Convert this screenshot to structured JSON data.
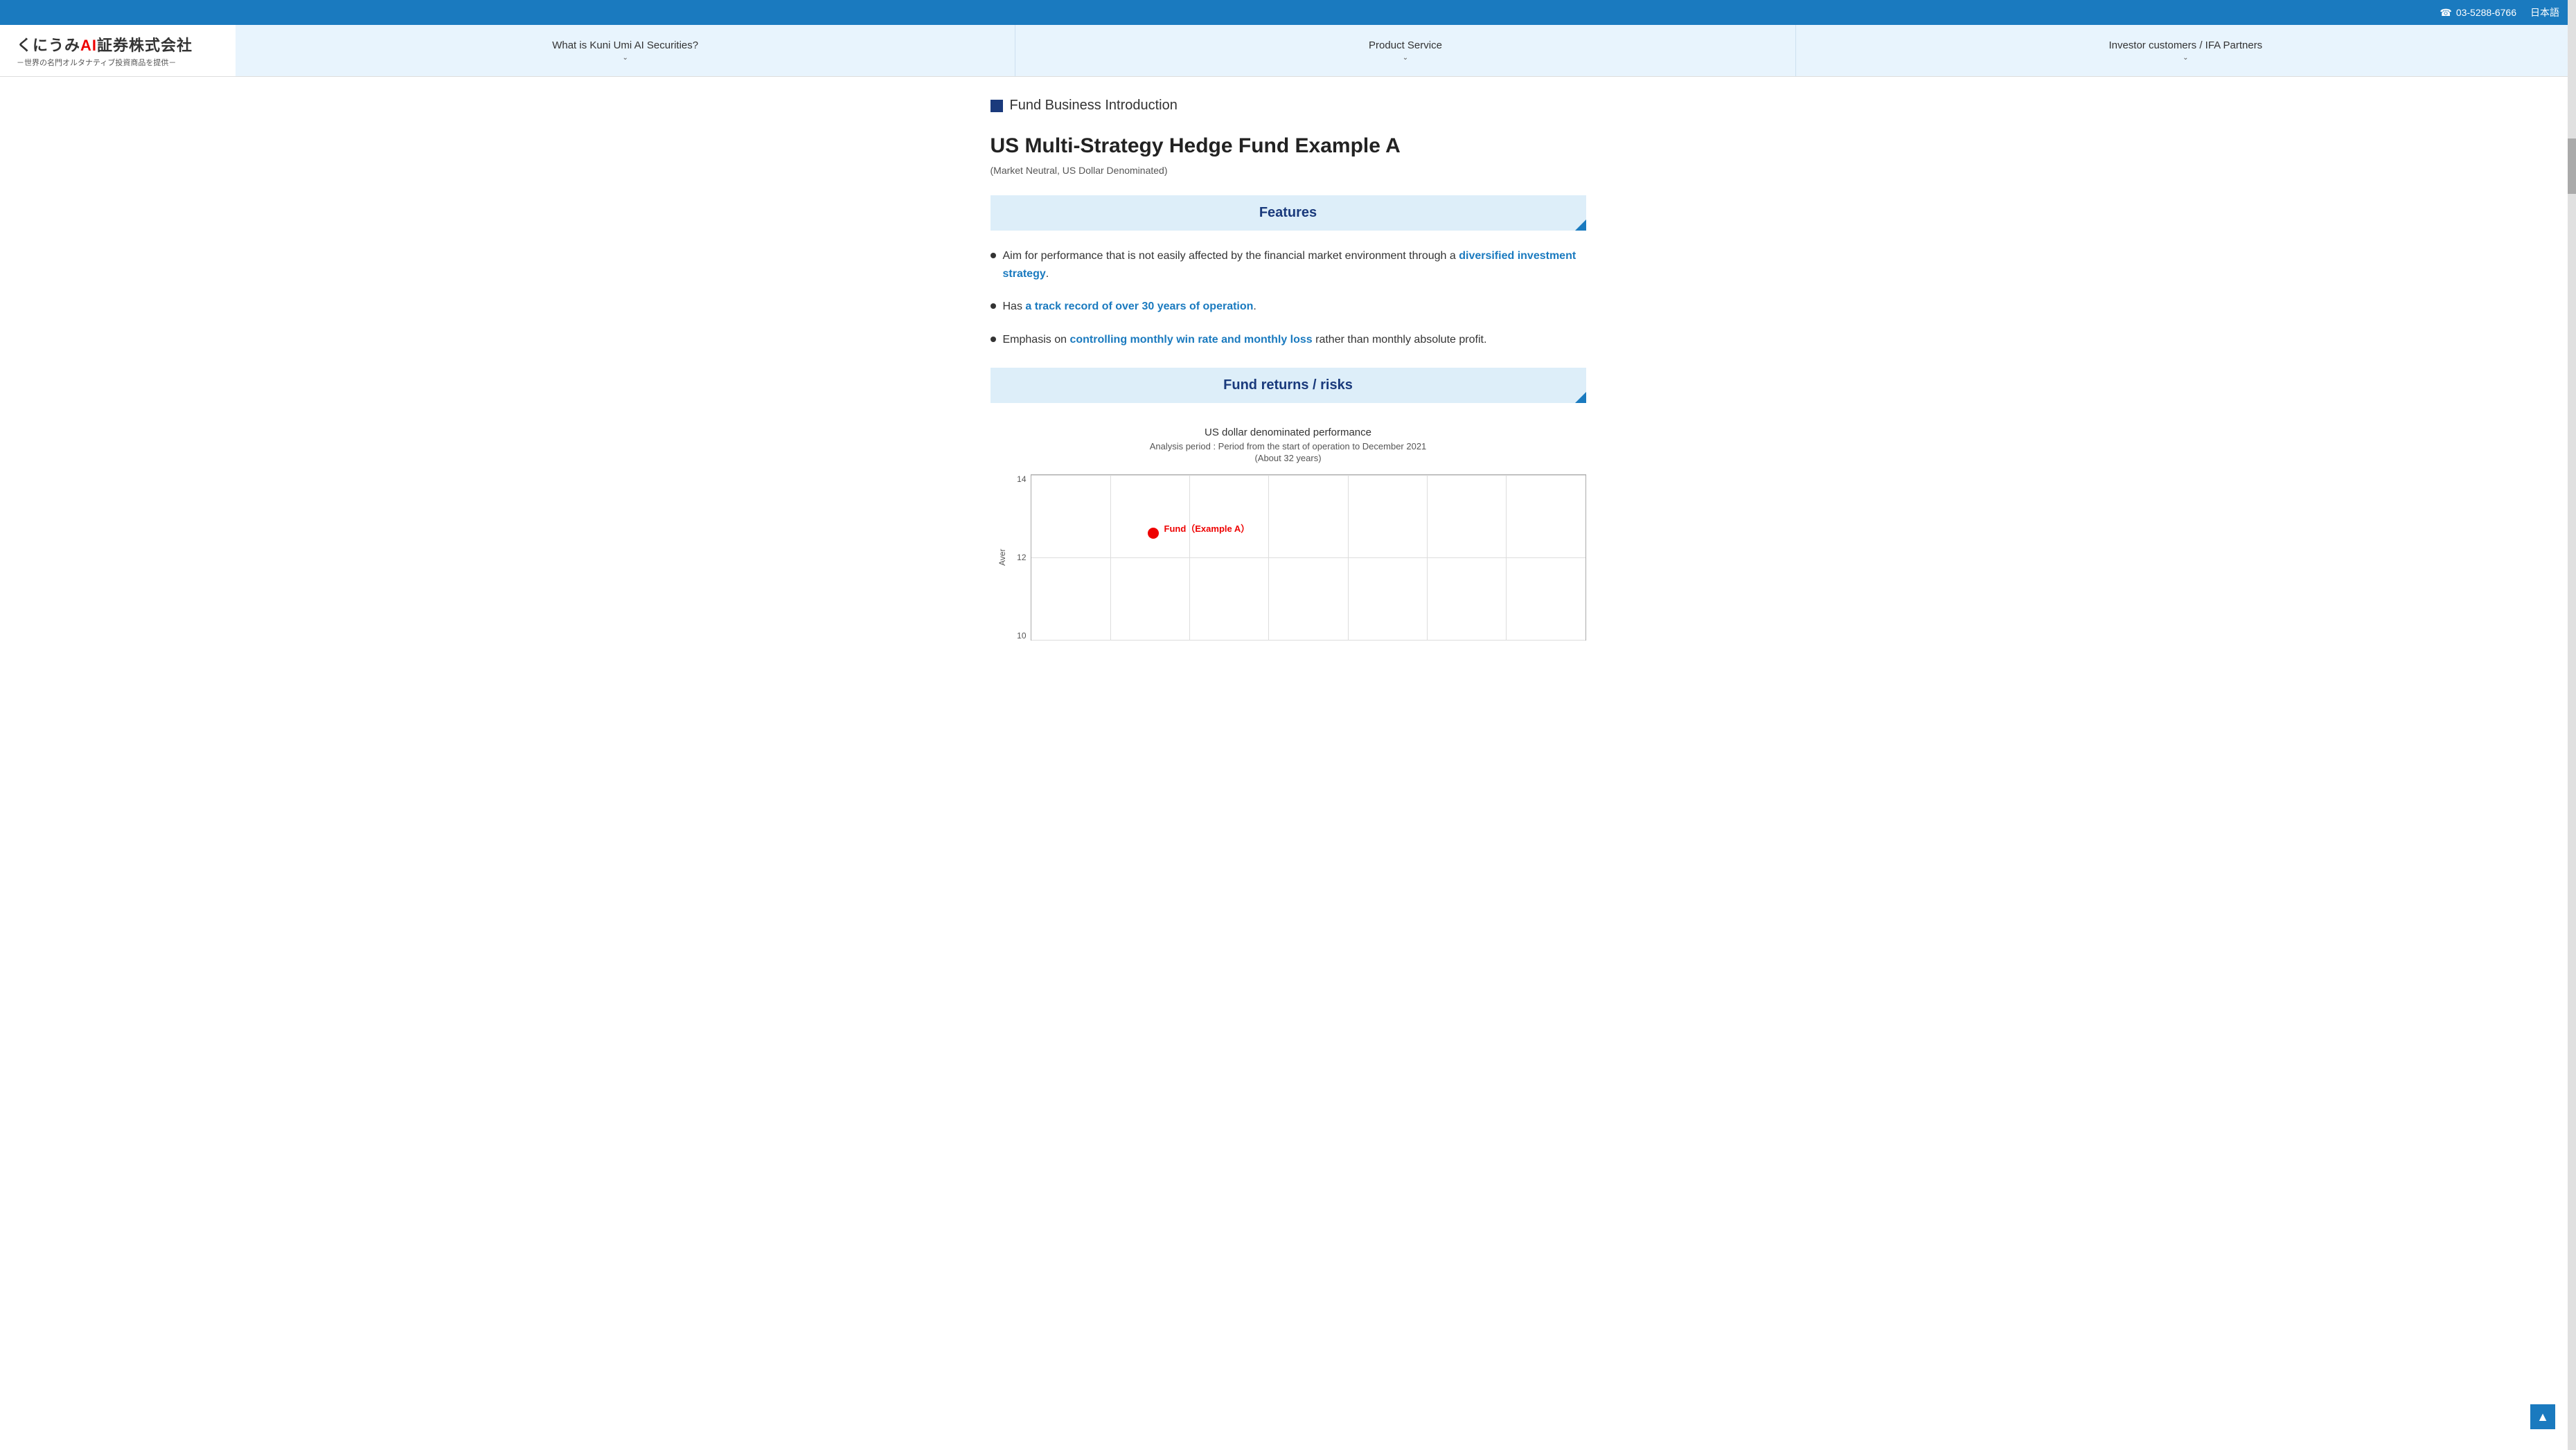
{
  "topbar": {
    "phone": "03-5288-6766",
    "phone_icon": "☎",
    "language": "日本語"
  },
  "logo": {
    "name_part1": "くにうみ",
    "name_ai": "AI",
    "name_part2": "証券株式会社",
    "tagline": "－世界の名門オルタナティブ投資商品を提供－"
  },
  "nav": {
    "items": [
      {
        "label": "What is Kuni Umi AI Securities?",
        "has_chevron": true
      },
      {
        "label": "Product Service",
        "has_chevron": true
      },
      {
        "label": "Investor customers / IFA Partners",
        "has_chevron": true
      }
    ]
  },
  "section_label": "Fund Business Introduction",
  "fund": {
    "title": "US Multi-Strategy Hedge Fund Example A",
    "subtitle": "(Market Neutral, US Dollar Denominated)"
  },
  "features": {
    "header": "Features",
    "bullets": [
      {
        "text_before": "Aim for performance that is not easily affected by the financial market environment through a ",
        "highlight": "diversified investment strategy",
        "text_after": "."
      },
      {
        "text_before": "Has ",
        "highlight": "a track record of over 30 years of operation",
        "text_after": "."
      },
      {
        "text_before": "Emphasis on ",
        "highlight": "controlling monthly win rate and monthly loss",
        "text_after": " rather than monthly absolute profit."
      }
    ]
  },
  "fund_returns": {
    "header": "Fund returns / risks",
    "chart": {
      "title": "US dollar denominated performance",
      "subtitle": "Analysis period : Period from the start of operation to December 2021",
      "period": "(About 32 years)",
      "y_label": "Aver",
      "y_ticks": [
        "14",
        "12",
        "10"
      ],
      "fund_dot": {
        "label": "Fund（Example A）",
        "x_percent": 22,
        "y_percent": 35
      }
    }
  },
  "scroll_to_top": "▲"
}
